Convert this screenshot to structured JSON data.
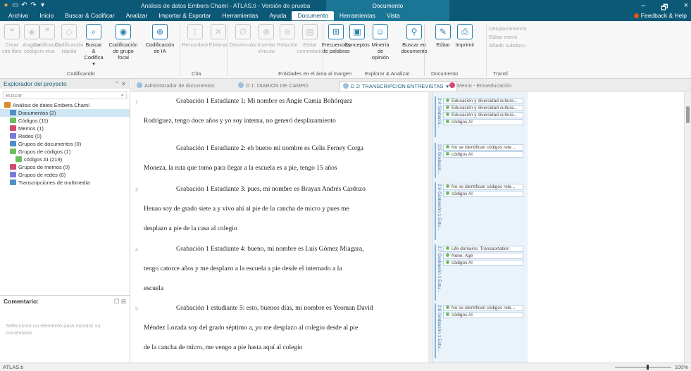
{
  "titlebar": {
    "app_title": "Análisis de datos Embera Chamí - ATLAS.ti - Versión de prueba",
    "context_title": "Documento",
    "quick_access": [
      "save-icon",
      "undo-icon",
      "redo-icon",
      "customize-icon"
    ],
    "window_controls": [
      "–",
      "🗗",
      "×"
    ]
  },
  "tabs": [
    "Archivo",
    "Inicio",
    "Buscar & Codificar",
    "Analizar",
    "Importar & Exportar",
    "Herramientas",
    "Ayuda",
    "Documento",
    "Herramientas",
    "Vista"
  ],
  "active_tab_index": 7,
  "feedback": "Feedback & Help",
  "ribbon": {
    "buttons": [
      {
        "label": "Crear cita libre",
        "icon": "quote-icon",
        "dim": true
      },
      {
        "label": "Asignar código",
        "icon": "code-icon",
        "dim": true
      },
      {
        "label": "Codificación in vivo",
        "icon": "in-vivo-icon",
        "dim": true
      },
      {
        "label": "Codificación rápida",
        "icon": "quick-code-icon",
        "dim": true
      },
      {
        "label": "Buscar & Codifica ▾",
        "icon": "search-code-icon",
        "dim": false
      },
      {
        "label": "Codificación de grupo focal",
        "icon": "focus-group-icon",
        "dim": false
      },
      {
        "label": "Codificación de IA",
        "icon": "ai-code-icon",
        "dim": false
      },
      {
        "label": "Renombrar",
        "icon": "rename-icon",
        "dim": true
      },
      {
        "label": "Eliminar",
        "icon": "delete-icon",
        "dim": true
      },
      {
        "label": "Desvincular",
        "icon": "unlink-icon",
        "dim": true
      },
      {
        "label": "Insertar vínculo",
        "icon": "link-icon",
        "dim": true
      },
      {
        "label": "Relación",
        "icon": "relation-icon",
        "dim": true
      },
      {
        "label": "Editar comentario",
        "icon": "comment-icon",
        "dim": true
      },
      {
        "label": "Frecuencias de palabras",
        "icon": "frequency-icon",
        "dim": false
      },
      {
        "label": "Conceptos",
        "icon": "concepts-icon",
        "dim": false
      },
      {
        "label": "Minería de opinión",
        "icon": "opinion-icon",
        "dim": false
      },
      {
        "label": "Buscar en documento",
        "icon": "search-icon",
        "dim": false
      },
      {
        "label": "Editar",
        "icon": "edit-icon",
        "dim": false
      },
      {
        "label": "Imprimir",
        "icon": "print-icon",
        "dim": false
      }
    ],
    "groups": [
      "Codificando",
      "Cita",
      "Entidades en el área al margen",
      "Explorar & Analizar",
      "Documento",
      "Transf"
    ],
    "small_items": [
      "Desplazamiento",
      "Editar menú",
      "Añadir subdocu"
    ]
  },
  "explorer": {
    "title": "Explorador del proyecto",
    "controls": "⌃ ✕",
    "search_placeholder": "Buscar",
    "items": [
      {
        "label": "Análisis de datos Embera Chamí",
        "color": "#d98b2b",
        "indent": 0
      },
      {
        "label": "Documentos (2)",
        "color": "#4f8fc9",
        "indent": 1
      },
      {
        "label": "Códigos (11)",
        "color": "#6cbf5f",
        "indent": 1
      },
      {
        "label": "Memos (1)",
        "color": "#d14b6f",
        "indent": 1
      },
      {
        "label": "Redes (0)",
        "color": "#7a7adb",
        "indent": 1
      },
      {
        "label": "Grupos de documentos (0)",
        "color": "#4f8fc9",
        "indent": 1
      },
      {
        "label": "Grupos de códigos (1)",
        "color": "#6cbf5f",
        "indent": 1
      },
      {
        "label": "códigos AI (219)",
        "color": "#6cbf5f",
        "indent": 2
      },
      {
        "label": "Grupos de memos (0)",
        "color": "#d14b6f",
        "indent": 1
      },
      {
        "label": "Grupos de redes (0)",
        "color": "#7a7adb",
        "indent": 1
      },
      {
        "label": "Transcripciones de multimedia",
        "color": "#4f8fc9",
        "indent": 1
      }
    ],
    "selected_index": 1
  },
  "comments": {
    "title": "Comentario:",
    "controls": "☐ ⊟",
    "hint": "Seleccione un elemento para mostrar su comentario"
  },
  "doc_tabs": [
    {
      "label": "Administrador de documentos",
      "color": "#9ec0dc",
      "active": false
    },
    {
      "label": "D 1: DIARIOS DE CAMPO",
      "color": "#9ec0dc",
      "active": false
    },
    {
      "label": "D 2: TRANSCRIPCION ENTREVISTAS",
      "color": "#9ec0dc",
      "active": true
    },
    {
      "label": "Memo - Etnoeducación",
      "color": "#d14b6f",
      "active": false
    }
  ],
  "doc_tab_close": "▾ ×",
  "document": {
    "paragraphs": [
      {
        "num": "1",
        "lines": [
          "Grabación 1 Estudiante 1: Mi nombre es Angie Camia Bohórquez",
          "Rodríguez, tengo doce años y yo soy interna, no generó desplazamiento"
        ]
      },
      {
        "num": "",
        "lines": [
          "Grabación 1 Estudiante 2: eh bueno mi nombre es Celis Ferney Corga",
          "Moneza, la ruta que tomo para llegar a la escuela es a pie, tengo 15 años"
        ]
      },
      {
        "num": "3",
        "lines": [
          "Grabación 1 Estudiante 3: pues, mi nombre es Brayan Andrés Cardozo",
          "Henao soy de grado siete a y vivo ahí al pie de la cancha de micro y pues me",
          "desplazo a pie de la casa al colegio"
        ]
      },
      {
        "num": "4",
        "lines": [
          "Grabación 1 Estudiante 4: bueno, mi nombre es Luis Gómez Miagara,",
          "tengo catorce años y me desplazo a la escuela a pie desde el internado a la",
          "escuela"
        ]
      },
      {
        "num": "5",
        "lines": [
          "Grabación 1 estudiante 5: esto, buenos días, mi nombre es Yeoman David",
          "Méndez Lozada soy del grado séptimo a, yo me desplazo al colegio desde al pie",
          "de la cancha de micro, me vengo a pie hasta aquí al colegio"
        ]
      }
    ]
  },
  "margin": {
    "quotations": [
      {
        "label": "2:4 Grabació...",
        "codes": [
          "Educación y diversidad cultura...",
          "Educación y diversidad cultura...",
          "Educación y diversidad cultura...",
          "códigos AI"
        ]
      },
      {
        "label": "2:5 Grabació...",
        "codes": [
          "No se identifican códigos rele...",
          "códigos AI"
        ]
      },
      {
        "label": "2:6 Grabación 1 Estu...",
        "codes": [
          "No se identifican códigos rele...",
          "códigos AI"
        ]
      },
      {
        "label": "2:7 Grabación 1 Estu...",
        "codes": [
          "Life domains: Transportation",
          "None: Age",
          "códigos AI"
        ]
      },
      {
        "label": "2:8 Grabación 1 Estu...",
        "codes": [
          "No se identifican códigos rele...",
          "códigos AI"
        ]
      }
    ]
  },
  "status": {
    "left": "ATLAS.ti",
    "zoom": "100%"
  }
}
